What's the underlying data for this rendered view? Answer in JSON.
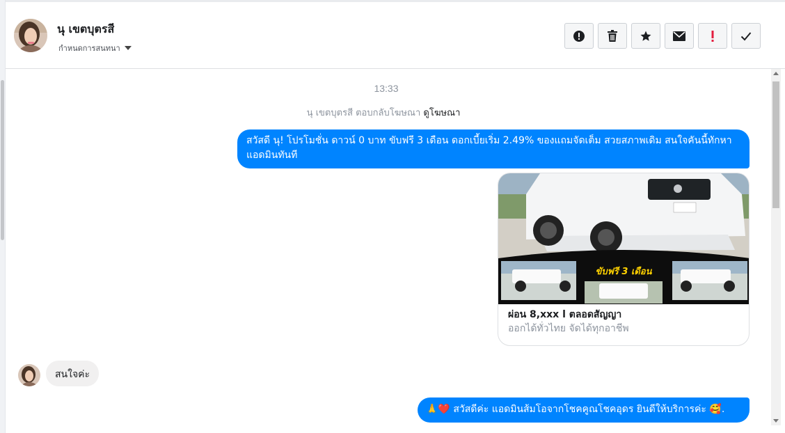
{
  "header": {
    "contact_name": "นุ เขตบุตรสี",
    "settings_label": "กำหนดการสนทนา",
    "actions": [
      {
        "name": "report-spam",
        "icon": "alert-circle-icon"
      },
      {
        "name": "delete",
        "icon": "trash-icon"
      },
      {
        "name": "star",
        "icon": "star-icon"
      },
      {
        "name": "mark-unread",
        "icon": "envelope-icon"
      },
      {
        "name": "mark-important",
        "icon": "exclamation-icon"
      },
      {
        "name": "mark-done",
        "icon": "checkmark-icon"
      }
    ]
  },
  "conversation": {
    "timestamp": "13:33",
    "reply_note": "นุ เขตบุตรสี ตอบกลับโฆษณา",
    "reply_link": "ดูโฆษณา",
    "messages": [
      {
        "from": "page",
        "text": "สวัสดี นุ! โปรโมชั่น ดาวน์ 0 บาท ขับฟรี 3 เดือน ดอกเบี้ยเริ่ม 2.49% ของแถมจัดเต็ม สวยสภาพเดิม สนใจคันนี้ทักหาแอดมินทันที"
      },
      {
        "from": "page",
        "type": "ad-card",
        "banner_text": "ขับฟรี 3 เดือน",
        "title": "ผ่อน 8,xxx l ตลอดสัญญา",
        "subtitle": "ออกได้ทั่วไทย จัดได้ทุกอาชีพ"
      },
      {
        "from": "user",
        "text": "สนใจค่ะ"
      },
      {
        "from": "page",
        "text": "🙏❤️ สวัสดีค่ะ แอดมินส้มโอจากโชคคูณโชคอุดร ยินดีให้บริการค่ะ 🥰."
      }
    ]
  },
  "colors": {
    "outgoing_bubble": "#0084ff",
    "incoming_bubble": "#f1f0f0",
    "important_red": "#e41e3f"
  }
}
